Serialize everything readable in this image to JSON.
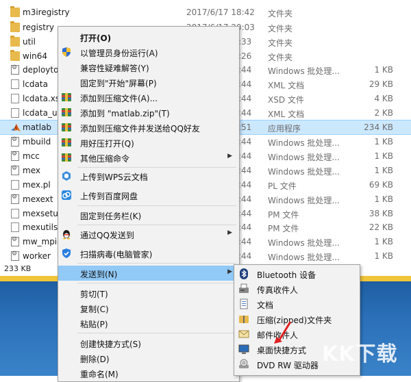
{
  "files": [
    {
      "name": "m3iregistry",
      "date": "2017/6/17 18:42",
      "type": "文件夹",
      "size": "",
      "icon": "folder-icon"
    },
    {
      "name": "registry",
      "date": "2017/6/17 20:03",
      "type": "文件夹",
      "size": "",
      "icon": "folder-icon"
    },
    {
      "name": "util",
      "date": ":33",
      "type": "文件夹",
      "size": "",
      "icon": "folder-icon"
    },
    {
      "name": "win64",
      "date": ":26",
      "type": "文件夹",
      "size": "",
      "icon": "folder-icon"
    },
    {
      "name": "deployto",
      "date": ":44",
      "type": "Windows 批处理...",
      "size": "1 KB",
      "icon": "gear-doc-icon"
    },
    {
      "name": "lcdata",
      "date": ":44",
      "type": "XML 文档",
      "size": "29 KB",
      "icon": "doc-icon"
    },
    {
      "name": "lcdata.xs",
      "date": ":44",
      "type": "XSD 文件",
      "size": "4 KB",
      "icon": "doc-icon"
    },
    {
      "name": "lcdata_ut",
      "date": ":44",
      "type": "XML 文档",
      "size": "2 KB",
      "icon": "doc-icon"
    },
    {
      "name": "matlab",
      "date": ":51",
      "type": "应用程序",
      "size": "234 KB",
      "icon": "matlab-icon"
    },
    {
      "name": "mbuild",
      "date": ":44",
      "type": "Windows 批处理...",
      "size": "1 KB",
      "icon": "gear-doc-icon"
    },
    {
      "name": "mcc",
      "date": ":44",
      "type": "Windows 批处理...",
      "size": "1 KB",
      "icon": "gear-doc-icon"
    },
    {
      "name": "mex",
      "date": ":44",
      "type": "Windows 批处理...",
      "size": "1 KB",
      "icon": "gear-doc-icon"
    },
    {
      "name": "mex.pl",
      "date": ":44",
      "type": "PL 文件",
      "size": "69 KB",
      "icon": "doc-icon"
    },
    {
      "name": "mexext",
      "date": ":44",
      "type": "Windows 批处理...",
      "size": "1 KB",
      "icon": "gear-doc-icon"
    },
    {
      "name": "mexsetu",
      "date": ":44",
      "type": "PM 文件",
      "size": "38 KB",
      "icon": "doc-icon"
    },
    {
      "name": "mexutils.",
      "date": ":44",
      "type": "PM 文件",
      "size": "22 KB",
      "icon": "doc-icon"
    },
    {
      "name": "mw_mpie",
      "date": ":44",
      "type": "Windows 批处理...",
      "size": "1 KB",
      "icon": "gear-doc-icon"
    },
    {
      "name": "worker",
      "date": ":44",
      "type": "Windows 批处理...",
      "size": "1 KB",
      "icon": "gear-doc-icon"
    }
  ],
  "status": {
    "text": "233 KB"
  },
  "context_menu": {
    "items": [
      {
        "label": "打开(O)",
        "icon": "",
        "arrow": ""
      },
      {
        "label": "以管理员身份运行(A)",
        "icon": "shield-icon",
        "arrow": ""
      },
      {
        "label": "兼容性疑难解答(Y)",
        "icon": "",
        "arrow": ""
      },
      {
        "label": "固定到\"开始\"屏幕(P)",
        "icon": "",
        "arrow": ""
      },
      {
        "label": "添加到压缩文件(A)...",
        "icon": "archive-icon",
        "arrow": ""
      },
      {
        "label": "添加到 \"matlab.zip\"(T)",
        "icon": "archive-icon",
        "arrow": ""
      },
      {
        "label": "添加到压缩文件并发送给QQ好友",
        "icon": "archive-icon",
        "arrow": ""
      },
      {
        "label": "用好压打开(Q)",
        "icon": "archive-icon",
        "arrow": ""
      },
      {
        "label": "其他压缩命令",
        "icon": "archive-icon",
        "arrow": "▶"
      },
      {
        "label": "上传到WPS云文档",
        "icon": "wps-cloud-icon",
        "arrow": ""
      },
      {
        "label": "上传到百度网盘",
        "icon": "baidu-cloud-icon",
        "arrow": ""
      },
      {
        "label": "固定到任务栏(K)",
        "icon": "",
        "arrow": ""
      },
      {
        "label": "通过QQ发送到",
        "icon": "qq-penguin-icon",
        "arrow": "▶"
      },
      {
        "label": "扫描病毒(电脑管家)",
        "icon": "guard-shield-icon",
        "arrow": ""
      },
      {
        "label": "发送到(N)",
        "icon": "",
        "arrow": "▶"
      },
      {
        "label": "剪切(T)",
        "icon": "",
        "arrow": ""
      },
      {
        "label": "复制(C)",
        "icon": "",
        "arrow": ""
      },
      {
        "label": "粘贴(P)",
        "icon": "",
        "arrow": ""
      },
      {
        "label": "创建快捷方式(S)",
        "icon": "",
        "arrow": ""
      },
      {
        "label": "删除(D)",
        "icon": "",
        "arrow": ""
      },
      {
        "label": "重命名(M)",
        "icon": "",
        "arrow": ""
      }
    ]
  },
  "send_to_menu": {
    "items": [
      {
        "label": "Bluetooth 设备",
        "icon": "bluetooth-icon"
      },
      {
        "label": "传真收件人",
        "icon": "fax-icon"
      },
      {
        "label": "文档",
        "icon": "documents-icon"
      },
      {
        "label": "压缩(zipped)文件夹",
        "icon": "zip-folder-icon"
      },
      {
        "label": "邮件收件人",
        "icon": "mail-icon"
      },
      {
        "label": "桌面快捷方式",
        "icon": "desktop-icon"
      },
      {
        "label": "DVD RW 驱动器",
        "icon": "dvd-drive-icon"
      }
    ]
  },
  "watermark": {
    "text": "KK下载"
  },
  "colors": {
    "selection": "#cce8ff",
    "menu_highlight": "#91c9f7",
    "menu_bg": "#f2f2f2",
    "folder": "#e8b94c",
    "desktop": "#2a6fb8"
  }
}
